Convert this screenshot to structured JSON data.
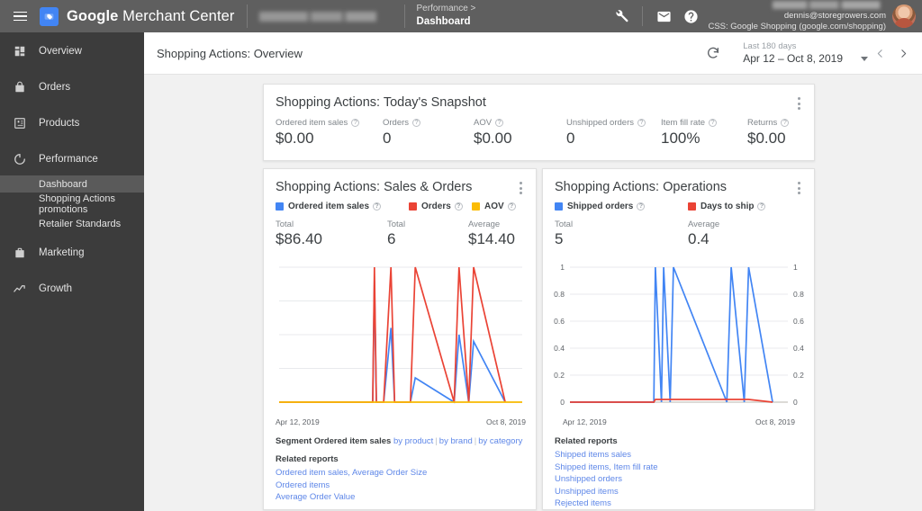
{
  "header": {
    "menu_icon": "hamburger-menu-icon",
    "logo_icon": "merchant-center-logo-icon",
    "brand_bold": "Google",
    "brand_light": " Merchant Center",
    "account_selector_blurred": true,
    "breadcrumb_parent": "Performance >",
    "breadcrumb_current": "Dashboard",
    "tools_icon": "wrench-icon",
    "mail_icon": "mail-icon",
    "help_icon": "help-icon",
    "account_email": "dennis@storegrowers.com",
    "account_css": "CSS: Google Shopping (google.com/shopping)",
    "avatar_icon": "user-avatar"
  },
  "sidebar": {
    "items": [
      {
        "label": "Overview",
        "icon": "dashboard-grid-icon",
        "active": false
      },
      {
        "label": "Orders",
        "icon": "shopping-bag-icon",
        "active": false
      },
      {
        "label": "Products",
        "icon": "products-tag-icon",
        "active": false
      },
      {
        "label": "Performance",
        "icon": "performance-circle-icon",
        "active": false
      },
      {
        "label": "Marketing",
        "icon": "marketing-briefcase-icon",
        "active": false
      },
      {
        "label": "Growth",
        "icon": "growth-trend-icon",
        "active": false
      }
    ],
    "sub_items": [
      {
        "label": "Dashboard",
        "active": true
      },
      {
        "label": "Shopping Actions promotions",
        "active": false
      },
      {
        "label": "Retailer Standards",
        "active": false
      }
    ]
  },
  "toolbar": {
    "title": "Shopping Actions: Overview",
    "refresh_icon": "refresh-icon",
    "date_preset_label": "Last 180 days",
    "date_range_value": "Apr 12 – Oct 8, 2019",
    "dropdown_icon": "chevron-down-icon",
    "prev_icon": "chevron-left-icon",
    "next_icon": "chevron-right-icon"
  },
  "snapshot_card": {
    "title": "Shopping Actions: Today's Snapshot",
    "menu_icon": "more-vert-icon",
    "metrics": [
      {
        "label": "Ordered item sales",
        "value": "$0.00"
      },
      {
        "label": "Orders",
        "value": "0"
      },
      {
        "label": "AOV",
        "value": "$0.00"
      },
      {
        "label": "Unshipped orders",
        "value": "0"
      },
      {
        "label": "Item fill rate",
        "value": "100%"
      },
      {
        "label": "Returns",
        "value": "$0.00"
      }
    ]
  },
  "sales_card": {
    "title": "Shopping Actions: Sales & Orders",
    "menu_icon": "more-vert-icon",
    "legend": [
      {
        "label": "Ordered item sales",
        "color": "#4285f4"
      },
      {
        "label": "Orders",
        "color": "#ea4335"
      },
      {
        "label": "AOV",
        "color": "#fbbc04"
      }
    ],
    "totals": [
      {
        "label": "Total",
        "value": "$86.40"
      },
      {
        "label": "Total",
        "value": "6"
      },
      {
        "label": "Average",
        "value": "$14.40"
      }
    ],
    "segment_prefix": "Segment Ordered item sales",
    "segment_links": [
      "by product",
      "by brand",
      "by category"
    ],
    "related_title": "Related reports",
    "related_links": [
      "Ordered item sales, Average Order Size",
      "Ordered items",
      "Average Order Value"
    ]
  },
  "ops_card": {
    "title": "Shopping Actions: Operations",
    "menu_icon": "more-vert-icon",
    "legend": [
      {
        "label": "Shipped orders",
        "color": "#4285f4"
      },
      {
        "label": "Days to ship",
        "color": "#ea4335"
      }
    ],
    "totals": [
      {
        "label": "Total",
        "value": "5"
      },
      {
        "label": "Average",
        "value": "0.4"
      }
    ],
    "related_title": "Related reports",
    "related_links": [
      "Shipped items sales",
      "Shipped items, Item fill rate",
      "Unshipped orders",
      "Unshipped items",
      "Rejected items"
    ]
  },
  "chart_data": [
    {
      "id": "sales-orders-chart",
      "type": "line",
      "title": "Shopping Actions: Sales & Orders",
      "xlabel": "",
      "ylabel": "",
      "x_tick_labels": [
        "Apr 12, 2019",
        "Oct 8, 2019"
      ],
      "x_range": [
        "Apr 12, 2019",
        "Oct 8, 2019"
      ],
      "y_axis_labels_shown": false,
      "ylim": [
        0,
        1
      ],
      "gridlines": 5,
      "legend_position": "top",
      "series": [
        {
          "name": "Ordered item sales",
          "color": "#4285f4",
          "x": [
            0,
            0.2,
            0.385,
            0.392,
            0.4,
            0.43,
            0.46,
            0.475,
            0.54,
            0.56,
            0.72,
            0.74,
            0.78,
            0.8,
            0.93
          ],
          "values": [
            0,
            0,
            0,
            0.9,
            0,
            0,
            0.55,
            0,
            0,
            0.18,
            0,
            0.5,
            0,
            0.45,
            0
          ]
        },
        {
          "name": "Orders",
          "color": "#ea4335",
          "x": [
            0,
            0.2,
            0.385,
            0.392,
            0.4,
            0.43,
            0.46,
            0.475,
            0.54,
            0.56,
            0.72,
            0.74,
            0.78,
            0.8,
            0.93
          ],
          "values": [
            0,
            0,
            0,
            1.0,
            0,
            0,
            1.0,
            0,
            0,
            1.0,
            0,
            1.0,
            0,
            1.0,
            0
          ]
        },
        {
          "name": "AOV",
          "color": "#fbbc04",
          "x": [
            0,
            1
          ],
          "values": [
            0,
            0
          ]
        }
      ]
    },
    {
      "id": "operations-chart",
      "type": "line",
      "title": "Shopping Actions: Operations",
      "xlabel": "",
      "ylabel": "",
      "x_tick_labels": [
        "Apr 12, 2019",
        "Oct 8, 2019"
      ],
      "x_range": [
        "Apr 12, 2019",
        "Oct 8, 2019"
      ],
      "y_tick_labels": [
        "0",
        "0.2",
        "0.4",
        "0.6",
        "0.8",
        "1"
      ],
      "y_axis_labels_shown": true,
      "ylim": [
        0,
        1
      ],
      "gridlines": 6,
      "legend_position": "top",
      "series": [
        {
          "name": "Shipped orders",
          "color": "#4285f4",
          "x": [
            0,
            0.2,
            0.385,
            0.392,
            0.42,
            0.43,
            0.46,
            0.475,
            0.72,
            0.74,
            0.8,
            0.82,
            0.93
          ],
          "values": [
            0,
            0,
            0,
            1.0,
            0,
            1.0,
            0,
            1.0,
            0,
            1.0,
            0,
            1.0,
            0
          ]
        },
        {
          "name": "Days to ship",
          "color": "#ea4335",
          "x": [
            0,
            0.385,
            0.392,
            0.43,
            0.475,
            0.74,
            0.82,
            0.93
          ],
          "values": [
            0,
            0,
            0.02,
            0.02,
            0.02,
            0.02,
            0.02,
            0
          ]
        }
      ]
    }
  ]
}
